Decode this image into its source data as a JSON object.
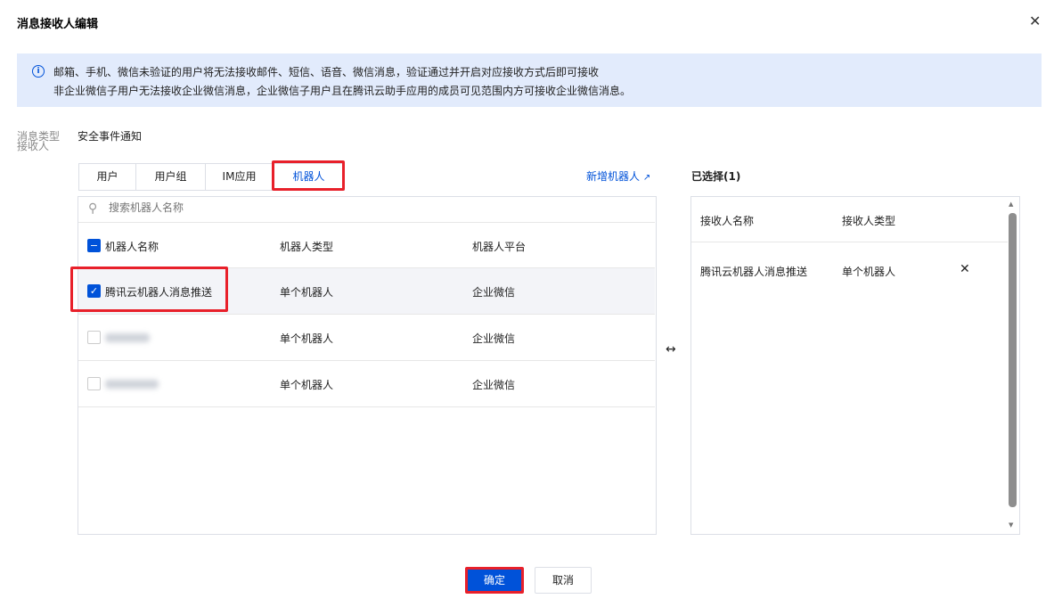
{
  "dialog": {
    "title": "消息接收人编辑"
  },
  "banner": {
    "line1": "邮箱、手机、微信未验证的用户将无法接收邮件、短信、语音、微信消息，验证通过并开启对应接收方式后即可接收",
    "line2": "非企业微信子用户无法接收企业微信消息，企业微信子用户且在腾讯云助手应用的成员可见范围内方可接收企业微信消息。"
  },
  "form": {
    "message_type_label": "消息类型",
    "message_type_value": "安全事件通知",
    "receiver_label": "接收人"
  },
  "tabs": [
    {
      "label": "用户"
    },
    {
      "label": "用户组"
    },
    {
      "label": "IM应用"
    },
    {
      "label": "机器人",
      "active": true
    }
  ],
  "add_robot_link": "新增机器人",
  "search": {
    "placeholder": "搜索机器人名称"
  },
  "table": {
    "headers": [
      "机器人名称",
      "机器人类型",
      "机器人平台"
    ],
    "rows": [
      {
        "name": "腾讯云机器人消息推送",
        "type": "单个机器人",
        "platform": "企业微信",
        "checked": true
      },
      {
        "name": "",
        "type": "单个机器人",
        "platform": "企业微信",
        "checked": false
      },
      {
        "name": "",
        "type": "单个机器人",
        "platform": "企业微信",
        "checked": false
      }
    ]
  },
  "selected": {
    "title": "已选择(1)",
    "headers": [
      "接收人名称",
      "接收人类型"
    ],
    "rows": [
      {
        "name": "腾讯云机器人消息推送",
        "type": "单个机器人"
      }
    ]
  },
  "footer": {
    "confirm": "确定",
    "cancel": "取消"
  },
  "colors": {
    "accent": "#0052d9",
    "highlight": "#e8202a"
  }
}
